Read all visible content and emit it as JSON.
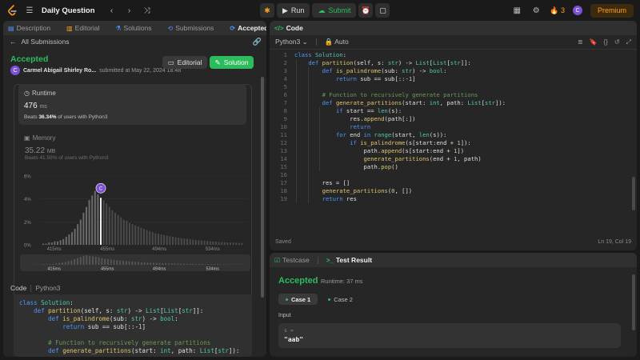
{
  "topbar": {
    "title": "Daily Question",
    "run_label": "Run",
    "submit_label": "Submit",
    "streak": "3",
    "avatar_letter": "C",
    "premium_label": "Premium"
  },
  "left_tabs": [
    {
      "label": "Description",
      "icon": "description-icon"
    },
    {
      "label": "Editorial",
      "icon": "editorial-icon"
    },
    {
      "label": "Solutions",
      "icon": "solutions-icon"
    },
    {
      "label": "Submissions",
      "icon": "submissions-icon"
    },
    {
      "label": "Accepted",
      "icon": "accepted-icon",
      "active": true
    }
  ],
  "submission": {
    "back_label": "All Submissions",
    "status": "Accepted",
    "author": "Carmel Abigail Shirley Ro...",
    "submitted": "submitted at May 22, 2024 18:48",
    "editorial_label": "Editorial",
    "solution_label": "Solution"
  },
  "runtime": {
    "label": "Runtime",
    "value": "476",
    "unit": "ms",
    "beats_prefix": "Beats",
    "beats_pct": "36.34%",
    "beats_suffix": "of users with Python3"
  },
  "memory": {
    "label": "Memory",
    "value": "35.22",
    "unit": "MB",
    "beats_prefix": "Beats",
    "beats_pct": "41.59%",
    "beats_suffix": "of users with Python3"
  },
  "chart_data": {
    "type": "bar",
    "title": "",
    "y_ticks": [
      "6%",
      "4%",
      "2%",
      "0%"
    ],
    "ylim": [
      0,
      6
    ],
    "x_ticks": [
      "415ms",
      "455ms",
      "494ms",
      "534ms"
    ],
    "x_tick_values": [
      415,
      455,
      494,
      534
    ],
    "xlim": [
      405,
      560
    ],
    "values": [
      0.1,
      0.1,
      0.2,
      0.2,
      0.3,
      0.3,
      0.4,
      0.5,
      0.7,
      0.9,
      1.1,
      1.4,
      1.8,
      2.2,
      2.8,
      3.3,
      3.9,
      4.3,
      4.7,
      4.4,
      4.1,
      3.9,
      3.6,
      3.3,
      3.0,
      2.8,
      2.6,
      2.4,
      2.2,
      2.1,
      1.9,
      1.8,
      1.7,
      1.6,
      1.5,
      1.4,
      1.3,
      1.2,
      1.1,
      1.0,
      0.95,
      0.9,
      0.85,
      0.8,
      0.75,
      0.7,
      0.66,
      0.62,
      0.58,
      0.55,
      0.52,
      0.48,
      0.45,
      0.42,
      0.4,
      0.38,
      0.36,
      0.33,
      0.31,
      0.29,
      0.27,
      0.25,
      0.23,
      0.21,
      0.2,
      0.19,
      0.18,
      0.17,
      0.16,
      0.15
    ],
    "highlight_index": 20,
    "marker_value": 476,
    "marker_label": "C"
  },
  "mini_chart_ticks": [
    "415ms",
    "455ms",
    "494ms",
    "534ms"
  ],
  "left_code": {
    "language_label": "Code",
    "language": "Python3"
  },
  "code_panel": {
    "title": "Code",
    "language": "Python3",
    "mode": "Auto",
    "status_left": "Saved",
    "status_right": "Ln 19, Col 19"
  },
  "code_lines": [
    "class Solution:",
    "    def partition(self, s: str) -> List[List[str]]:",
    "        def is_palindrome(sub: str) -> bool:",
    "            return sub == sub[::-1]",
    "",
    "        # Function to recursively generate partitions",
    "        def generate_partitions(start: int, path: List[str]):",
    "            if start == len(s):",
    "                res.append(path[:])",
    "                return",
    "            for end in range(start, len(s)):",
    "                if is_palindrome(s[start:end + 1]):",
    "                    path.append(s[start:end + 1])",
    "                    generate_partitions(end + 1, path)",
    "                    path.pop()",
    "",
    "        res = []",
    "        generate_partitions(0, [])",
    "        return res"
  ],
  "test_panel": {
    "tab_testcase": "Testcase",
    "tab_result": "Test Result",
    "status": "Accepted",
    "runtime": "Runtime: 37 ms",
    "case1": "Case 1",
    "case2": "Case 2",
    "input_label": "Input",
    "input_var": "s =",
    "input_value": "\"aab\""
  }
}
